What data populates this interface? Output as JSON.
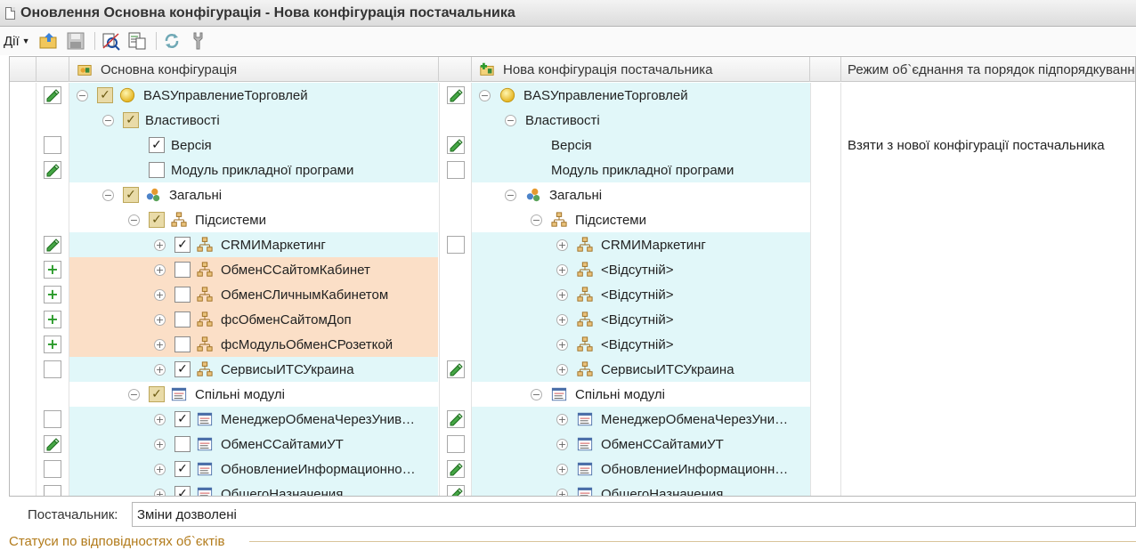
{
  "window": {
    "title": "Оновлення Основна конфігурація - Нова конфігурація постачальника"
  },
  "toolbar": {
    "actions_label": "Дії",
    "buttons": [
      "open-icon",
      "save-icon",
      "compare-icon",
      "report-icon",
      "refresh-icon",
      "settings-icon"
    ]
  },
  "columns": {
    "main": "Основна конфігурація",
    "vendor": "Нова конфігурація постачальника",
    "mode": "Режим об`єднання та порядок підпорядкування"
  },
  "rows": [
    {
      "bg": "cyan",
      "mark_left": "pencil",
      "lvl": 0,
      "twist": "minus",
      "check": "tri",
      "icon": "ball",
      "left": "BASУправлениеТорговлей",
      "mark_right": "pencil",
      "right": "BASУправлениеТорговлей",
      "right_icon": "ball",
      "right_twist": "minus",
      "mode": ""
    },
    {
      "bg": "cyan",
      "mark_left": "",
      "lvl": 1,
      "twist": "minus",
      "check": "tri",
      "icon": "",
      "left": "Властивості",
      "mark_right": "",
      "right": "Властивості",
      "right_icon": "",
      "right_twist": "minus",
      "mode": ""
    },
    {
      "bg": "cyan",
      "mark_left": "empty",
      "lvl": 2,
      "twist": "",
      "check": "checked",
      "icon": "",
      "left": "Версія",
      "mark_right": "pencil",
      "right": "Версія",
      "right_icon": "",
      "right_twist": "",
      "mode": "Взяти з нової конфігурації постачальника"
    },
    {
      "bg": "cyan",
      "mark_left": "pencil",
      "lvl": 2,
      "twist": "",
      "check": "empty",
      "icon": "",
      "left": "Модуль прикладної програми",
      "mark_right": "empty",
      "right": "Модуль прикладної програми",
      "right_icon": "",
      "right_twist": "",
      "mode": ""
    },
    {
      "bg": "",
      "mark_left": "",
      "lvl": 1,
      "twist": "minus",
      "check": "tri",
      "icon": "common",
      "left": "Загальні",
      "mark_right": "",
      "right": "Загальні",
      "right_icon": "common",
      "right_twist": "minus",
      "mode": ""
    },
    {
      "bg": "",
      "mark_left": "",
      "lvl": 2,
      "twist": "minus",
      "check": "tri",
      "icon": "subsys",
      "left": "Підсистеми",
      "mark_right": "",
      "right": "Підсистеми",
      "right_icon": "subsys",
      "right_twist": "minus",
      "mode": ""
    },
    {
      "bg": "cyan",
      "mark_left": "pencil",
      "lvl": 3,
      "twist": "plus",
      "check": "checked",
      "icon": "subsys",
      "left": "CRMИМаркетинг",
      "mark_right": "empty",
      "right": "CRMИМаркетинг",
      "right_icon": "subsys",
      "right_twist": "plus",
      "mode": ""
    },
    {
      "bg": "orange",
      "mark_left": "plus",
      "lvl": 3,
      "twist": "plus",
      "check": "empty",
      "icon": "subsys",
      "left": "ОбменССайтомКабинет",
      "mark_right": "",
      "right": "<Відсутній>",
      "right_icon": "subsys",
      "right_twist": "plus",
      "mode": ""
    },
    {
      "bg": "orange",
      "mark_left": "plus",
      "lvl": 3,
      "twist": "plus",
      "check": "empty",
      "icon": "subsys",
      "left": "ОбменСЛичнымКабинетом",
      "mark_right": "",
      "right": "<Відсутній>",
      "right_icon": "subsys",
      "right_twist": "plus",
      "mode": ""
    },
    {
      "bg": "orange",
      "mark_left": "plus",
      "lvl": 3,
      "twist": "plus",
      "check": "empty",
      "icon": "subsys",
      "left": "фсОбменСайтомДоп",
      "mark_right": "",
      "right": "<Відсутній>",
      "right_icon": "subsys",
      "right_twist": "plus",
      "mode": ""
    },
    {
      "bg": "orange",
      "mark_left": "plus",
      "lvl": 3,
      "twist": "plus",
      "check": "empty",
      "icon": "subsys",
      "left": "фсМодульОбменСРозеткой",
      "mark_right": "",
      "right": "<Відсутній>",
      "right_icon": "subsys",
      "right_twist": "plus",
      "mode": ""
    },
    {
      "bg": "cyan",
      "mark_left": "empty",
      "lvl": 3,
      "twist": "plus",
      "check": "checked",
      "icon": "subsys",
      "left": "СервисыИТСУкраина",
      "mark_right": "pencil",
      "right": "СервисыИТСУкраина",
      "right_icon": "subsys",
      "right_twist": "plus",
      "mode": ""
    },
    {
      "bg": "",
      "mark_left": "",
      "lvl": 2,
      "twist": "minus",
      "check": "tri",
      "icon": "module",
      "left": "Спільні модулі",
      "mark_right": "",
      "right": "Спільні модулі",
      "right_icon": "module",
      "right_twist": "minus",
      "mode": ""
    },
    {
      "bg": "cyan",
      "mark_left": "empty",
      "lvl": 3,
      "twist": "plus",
      "check": "checked",
      "icon": "module",
      "left": "МенеджерОбменаЧерезУнив…",
      "mark_right": "pencil",
      "right": "МенеджерОбменаЧерезУни…",
      "right_icon": "module",
      "right_twist": "plus",
      "mode": ""
    },
    {
      "bg": "cyan",
      "mark_left": "pencil",
      "lvl": 3,
      "twist": "plus",
      "check": "empty",
      "icon": "module",
      "left": "ОбменССайтамиУТ",
      "mark_right": "empty",
      "right": "ОбменССайтамиУТ",
      "right_icon": "module",
      "right_twist": "plus",
      "mode": ""
    },
    {
      "bg": "cyan",
      "mark_left": "empty",
      "lvl": 3,
      "twist": "plus",
      "check": "checked",
      "icon": "module",
      "left": "ОбновлениеИнформационно…",
      "mark_right": "pencil",
      "right": "ОбновлениеИнформационн…",
      "right_icon": "module",
      "right_twist": "plus",
      "mode": ""
    },
    {
      "bg": "cyan",
      "mark_left": "empty",
      "lvl": 3,
      "twist": "plus",
      "check": "checked",
      "icon": "module",
      "left": "ОбщегоНазначения",
      "mark_right": "pencil",
      "right": "ОбщегоНазначения",
      "right_icon": "module",
      "right_twist": "plus",
      "mode": ""
    }
  ],
  "supplier": {
    "label": "Постачальник:",
    "value": "Зміни дозволені"
  },
  "status": {
    "label": "Статуси по відповідностях об`єктів"
  },
  "colors": {
    "cyan": "#e1f7f9",
    "orange": "#fbdfc7",
    "status_text": "#b27b1b"
  }
}
